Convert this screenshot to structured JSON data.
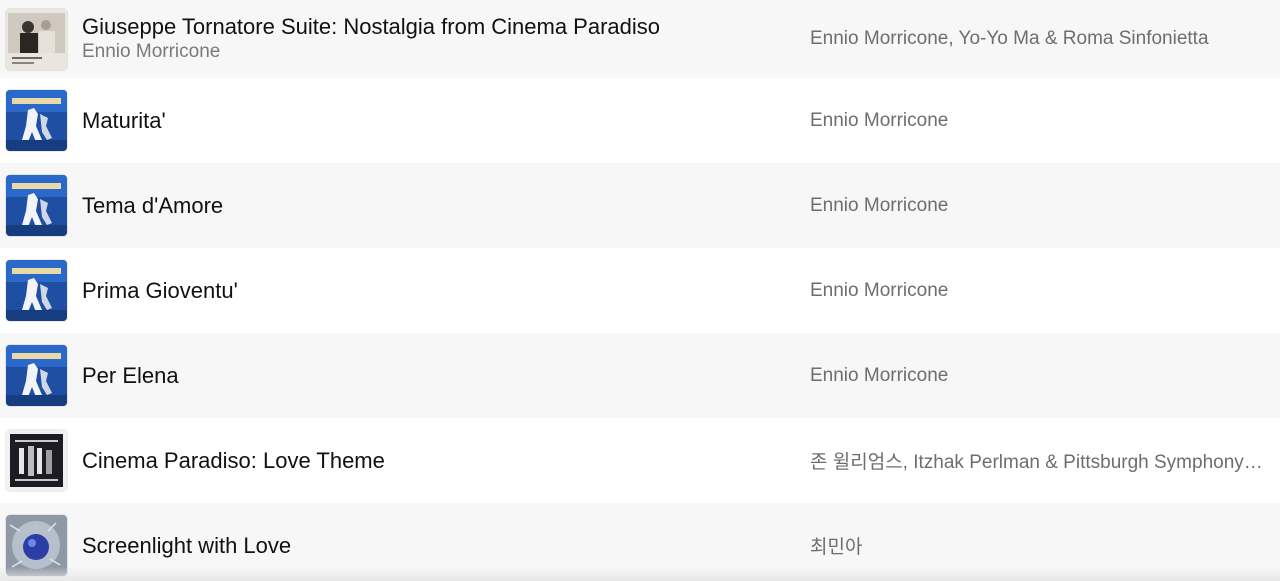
{
  "tracks": [
    {
      "title": "Giuseppe Tornatore Suite: Nostalgia from Cinema Paradiso",
      "subtitle": "Ennio Morricone",
      "artist": "Ennio Morricone, Yo-Yo Ma & Roma Sinfonietta",
      "art": "photo-duo-cover"
    },
    {
      "title": "Maturita'",
      "artist": "Ennio Morricone",
      "art": "paradiso-cover"
    },
    {
      "title": "Tema d'Amore",
      "artist": "Ennio Morricone",
      "art": "paradiso-cover"
    },
    {
      "title": "Prima Gioventu'",
      "artist": "Ennio Morricone",
      "art": "paradiso-cover"
    },
    {
      "title": "Per Elena",
      "artist": "Ennio Morricone",
      "art": "paradiso-cover"
    },
    {
      "title": "Cinema Paradiso: Love Theme",
      "artist": "존 윌리엄스, Itzhak Perlman & Pittsburgh Symphony…",
      "art": "perlman-williams-cover"
    },
    {
      "title": "Screenlight with Love",
      "artist": "최민아",
      "art": "blue-orb-cover"
    }
  ]
}
